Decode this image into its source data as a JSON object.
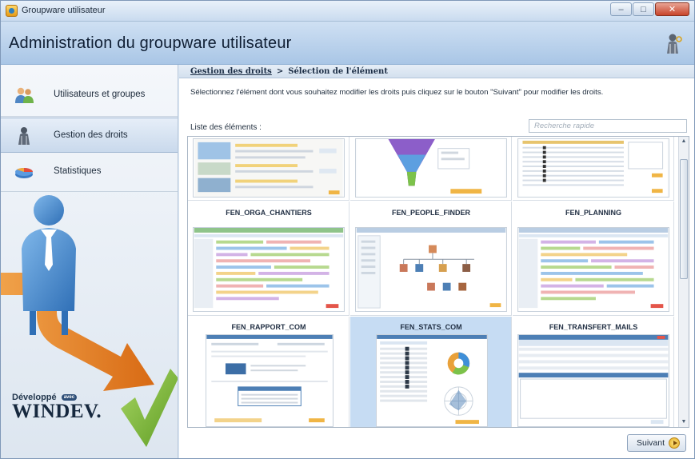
{
  "window": {
    "title": "Groupware utilisateur",
    "minimize_glyph": "–",
    "maximize_glyph": "□",
    "close_glyph": "✕"
  },
  "header": {
    "title": "Administration du groupware utilisateur",
    "icon": "user-key-icon"
  },
  "sidebar": {
    "items": [
      {
        "label": "Utilisateurs et groupes",
        "icon": "users-icon",
        "active": false
      },
      {
        "label": "Gestion des droits",
        "icon": "key-user-icon",
        "active": true
      },
      {
        "label": "Statistiques",
        "icon": "pie-chart-icon",
        "active": false
      }
    ],
    "brand": {
      "developed_by": "Développé",
      "badge": "avec",
      "product": "WINDEV."
    }
  },
  "main": {
    "breadcrumb": {
      "parent": "Gestion des droits",
      "separator": ">",
      "current": "Sélection de l'élément"
    },
    "instruction": "Sélectionnez l'élément dont vous souhaitez modifier les droits puis cliquez sur le bouton \"Suivant\" pour modifier les droits.",
    "list_label": "Liste des éléments :",
    "search_placeholder": "Recherche rapide",
    "tiles": [
      {
        "name": "",
        "kind": "form",
        "selected": false
      },
      {
        "name": "",
        "kind": "funnel",
        "selected": false
      },
      {
        "name": "",
        "kind": "table",
        "selected": false
      },
      {
        "name": "FEN_ORGA_CHANTIERS",
        "kind": "gantt",
        "selected": false
      },
      {
        "name": "FEN_PEOPLE_FINDER",
        "kind": "orgchart",
        "selected": false
      },
      {
        "name": "FEN_PLANNING",
        "kind": "gantt",
        "selected": false
      },
      {
        "name": "FEN_RAPPORT_COM",
        "kind": "report",
        "selected": false
      },
      {
        "name": "FEN_STATS_COM",
        "kind": "stats",
        "selected": true
      },
      {
        "name": "FEN_TRANSFERT_MAILS",
        "kind": "mailgrid",
        "selected": false
      }
    ],
    "next_button": "Suivant"
  }
}
